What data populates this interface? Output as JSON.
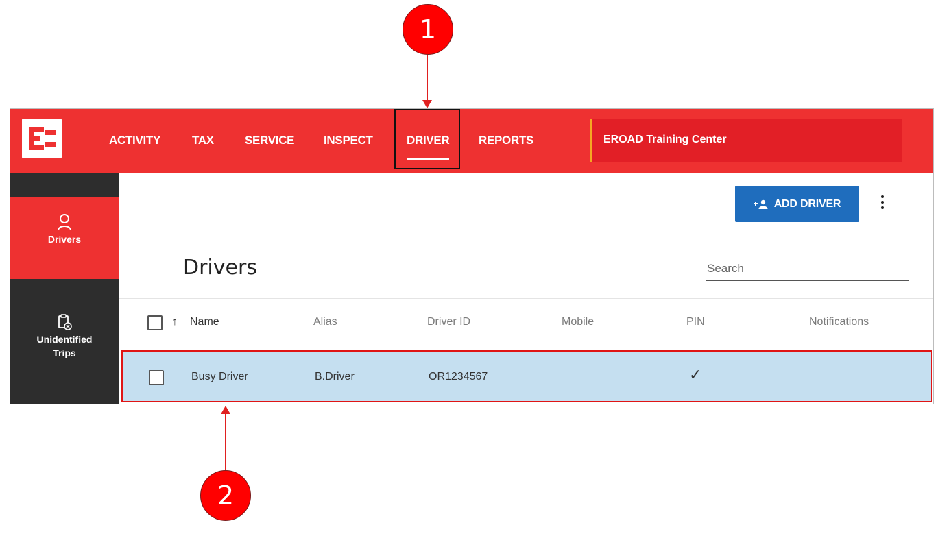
{
  "annotations": {
    "callout_1": "1",
    "callout_2": "2"
  },
  "nav": {
    "items": [
      "ACTIVITY",
      "TAX",
      "SERVICE",
      "INSPECT",
      "DRIVER",
      "REPORTS"
    ],
    "active": "DRIVER",
    "organization": "EROAD Training Center"
  },
  "sidebar": {
    "items": [
      {
        "label": "Drivers",
        "icon": "person-outline-icon",
        "active": true
      },
      {
        "label_line1": "Unidentified",
        "label_line2": "Trips",
        "icon": "clipboard-x-icon",
        "active": false
      }
    ]
  },
  "main": {
    "add_button_label": "ADD DRIVER",
    "add_button_icon": "add-person-icon",
    "title": "Drivers",
    "search_placeholder": "Search",
    "columns": [
      "Name",
      "Alias",
      "Driver ID",
      "Mobile",
      "PIN",
      "Notifications"
    ],
    "sort_indicator": "↑",
    "rows": [
      {
        "name": "Busy Driver",
        "alias": "B.Driver",
        "driver_id": "OR1234567",
        "mobile": "",
        "pin": "✓",
        "notifications": ""
      }
    ]
  },
  "colors": {
    "brand_red": "#ee3131",
    "sidebar_dark": "#2d2d2d",
    "button_blue": "#1f6dbd",
    "selected_row": "#c5dff0",
    "highlight_border": "#e01515"
  }
}
